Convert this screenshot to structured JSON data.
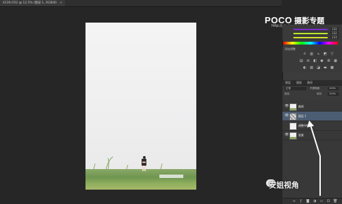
{
  "document_tab": {
    "label": "4139.CR2 @ 12.5% (图层 1, RGB/8)",
    "close_glyph": "×"
  },
  "watermark_logo": {
    "brand": "POCO",
    "title": "摄影专题",
    "url": "http://photo.poco.cn/"
  },
  "color_panel": {
    "values": [
      "232",
      "232",
      "233"
    ],
    "colors": [
      "#7a2ec9",
      "#b8e82a",
      "#d4e226"
    ]
  },
  "adjustments_panel": {
    "title": "添加调整"
  },
  "layers_panel": {
    "tabs": [
      "图层",
      "通道",
      "路径"
    ],
    "blend_mode": "正常",
    "opacity_label": "不透明度:",
    "opacity_value": "100%",
    "fill_label": "填充:",
    "fill_value": "100%",
    "lock_label": "锁定:",
    "layers": [
      {
        "name": "曲线",
        "visible": true,
        "thumb": "photo",
        "selected": false
      },
      {
        "name": "图层 1",
        "visible": true,
        "thumb": "adj",
        "selected": true
      },
      {
        "name": "调整中性",
        "visible": false,
        "thumb": "white",
        "selected": false
      },
      {
        "name": "背景",
        "visible": true,
        "thumb": "photo",
        "selected": false
      }
    ]
  },
  "overlay_text": {
    "wechat_watermark": "安姐视角"
  },
  "colors": {
    "selected_layer": "#4b5d73",
    "arrow": "#ffffff"
  }
}
